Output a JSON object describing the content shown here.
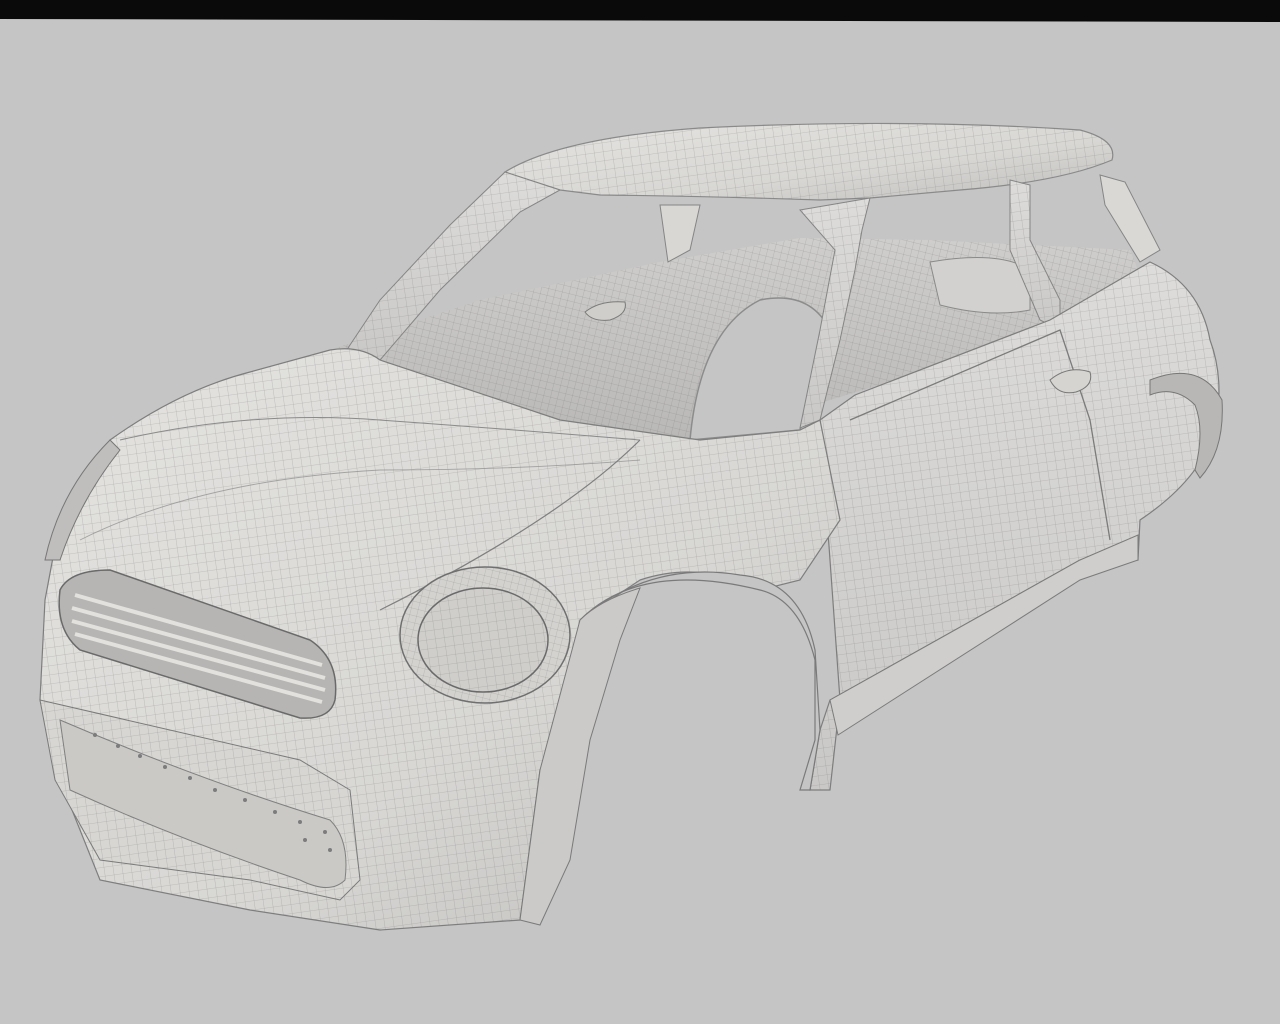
{
  "viewport": {
    "background_color": "#c5c5c5",
    "top_band_color": "#0a0a0a"
  },
  "model": {
    "subject": "car-body-shell-wireframe-icon",
    "surface_color": "#dcdbd8",
    "shadow_color": "#a9a9a9",
    "wire_color": "#6e6e6e"
  }
}
